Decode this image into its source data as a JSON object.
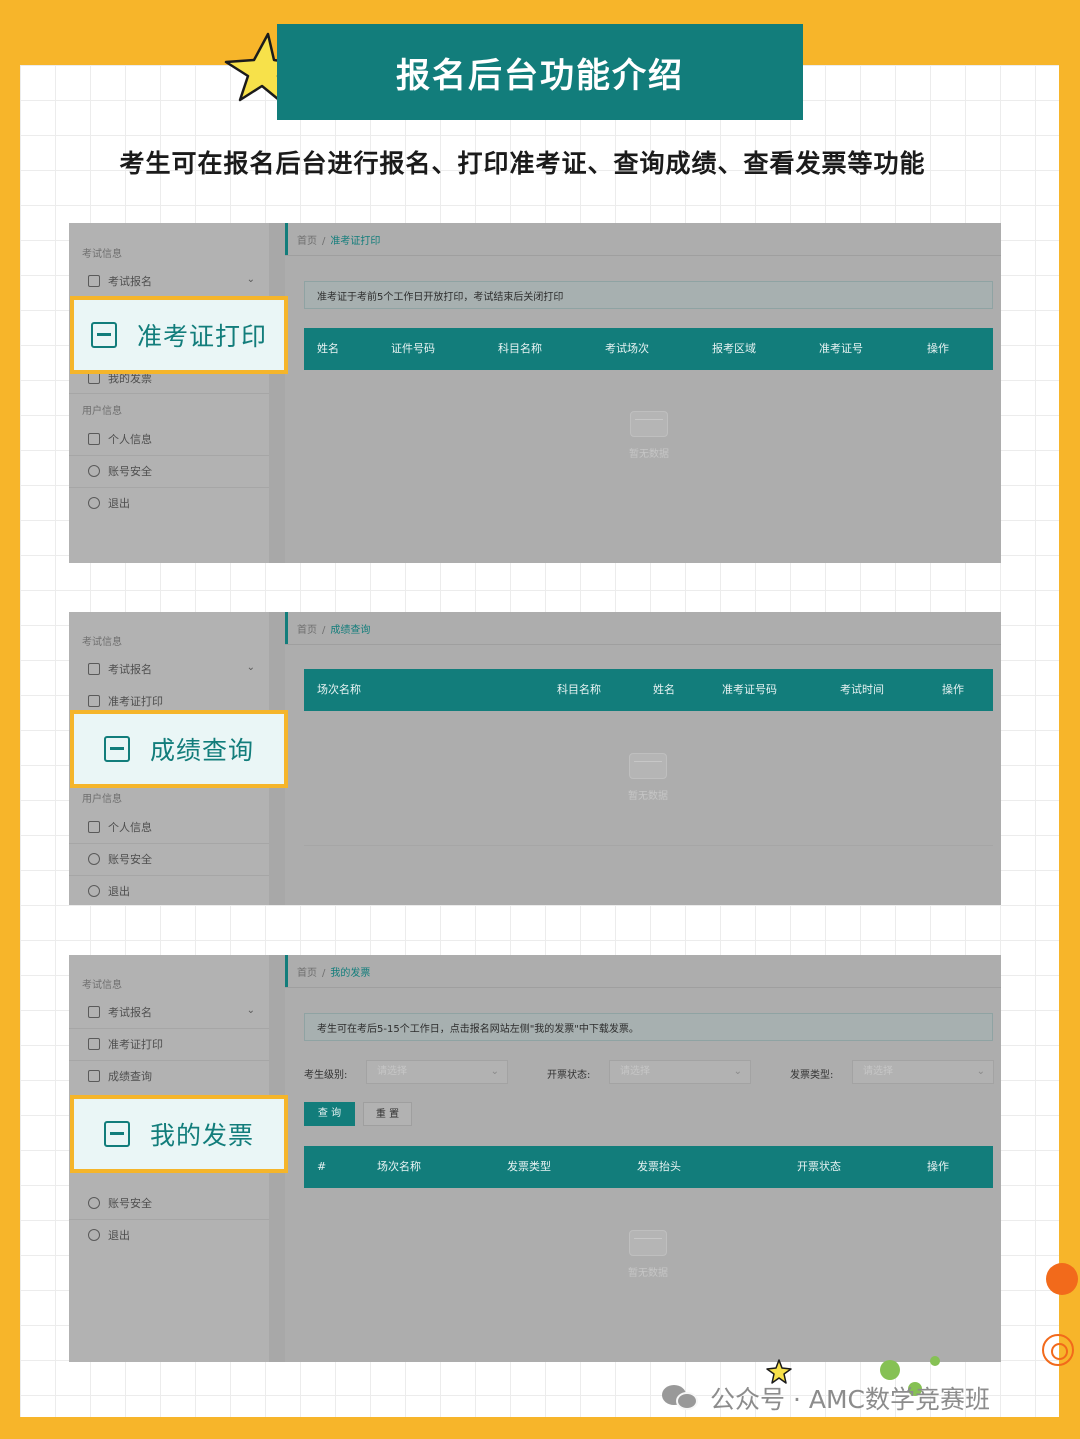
{
  "header": {
    "title": "报名后台功能介绍",
    "subtitle": "考生可在报名后台进行报名、打印准考证、查询成绩、查看发票等功能"
  },
  "sidebar": {
    "exam_info": "考试信息",
    "exam_signup": "考试报名",
    "ticket_print": "准考证打印",
    "score_query": "成绩查询",
    "my_invoice": "我的发票",
    "user_info": "用户信息",
    "profile": "个人信息",
    "account_security": "账号安全",
    "logout": "退出"
  },
  "breadcrumb_home": "首页",
  "breadcrumb_sep": "/",
  "empty_text": "暂无数据",
  "panel1": {
    "current": "准考证打印",
    "notice": "准考证于考前5个工作日开放打印，考试结束后关闭打印",
    "columns": [
      "姓名",
      "证件号码",
      "科目名称",
      "考试场次",
      "报考区域",
      "准考证号",
      "操作"
    ],
    "callout": "准考证打印"
  },
  "panel2": {
    "current": "成绩查询",
    "columns": [
      "场次名称",
      "科目名称",
      "姓名",
      "准考证号码",
      "考试时间",
      "操作"
    ],
    "callout": "成绩查询"
  },
  "panel3": {
    "current": "我的发票",
    "notice": "考生可在考后5-15个工作日，点击报名网站左侧\"我的发票\"中下载发票。",
    "filters": [
      {
        "label": "考生级别:",
        "placeholder": "请选择"
      },
      {
        "label": "开票状态:",
        "placeholder": "请选择"
      },
      {
        "label": "发票类型:",
        "placeholder": "请选择"
      }
    ],
    "query_btn": "查 询",
    "reset_btn": "重 置",
    "columns": [
      "#",
      "场次名称",
      "发票类型",
      "发票抬头",
      "开票状态",
      "操作"
    ],
    "callout": "我的发票"
  },
  "footer": {
    "account": "公众号 · AMC数学竞赛班"
  },
  "colors": {
    "brand_teal": "#127d7b",
    "highlight_yellow": "#f5b52a",
    "background_yellow": "#f7b52a"
  }
}
